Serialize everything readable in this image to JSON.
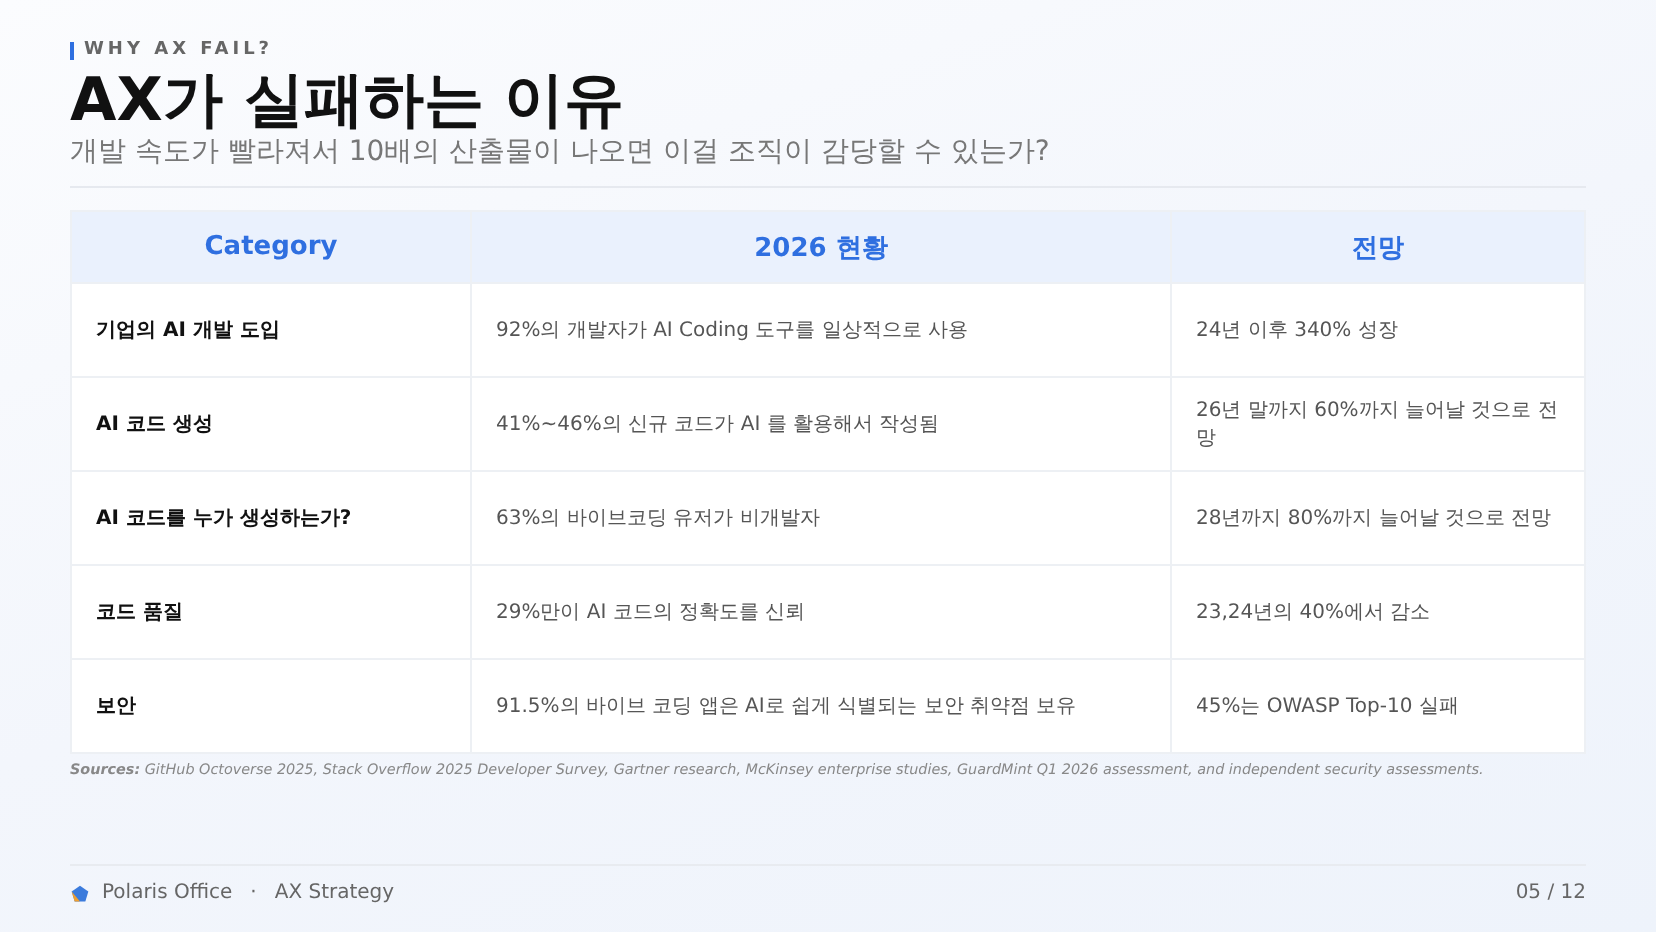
{
  "header": {
    "eyebrow": "WHY AX FAIL?",
    "title": "AX가 실패하는 이유",
    "subtitle": "개발 속도가 빨라져서 10배의 산출물이 나오면 이걸 조직이 감당할 수 있는가?"
  },
  "table": {
    "columns": [
      "Category",
      "2026 현황",
      "전망"
    ],
    "rows": [
      [
        "기업의 AI 개발 도입",
        "92%의 개발자가 AI Coding 도구를 일상적으로 사용",
        "24년 이후 340% 성장"
      ],
      [
        "AI 코드 생성",
        "41%~46%의 신규 코드가 AI 를 활용해서 작성됨",
        "26년 말까지 60%까지 늘어날 것으로 전망"
      ],
      [
        "AI 코드를 누가 생성하는가?",
        "63%의 바이브코딩 유저가 비개발자",
        "28년까지 80%까지 늘어날 것으로 전망"
      ],
      [
        "코드 품질",
        "29%만이 AI 코드의 정확도를 신뢰",
        "23,24년의 40%에서 감소"
      ],
      [
        "보안",
        "91.5%의 바이브 코딩 앱은 AI로 쉽게 식별되는 보안 취약점 보유",
        "45%는 OWASP Top-10 실패"
      ]
    ]
  },
  "sources": "**Sources:** GitHub Octoverse 2025, Stack Overflow 2025 Developer Survey, Gartner research, McKinsey enterprise studies, GuardMint Q1 2026 assessment, and independent security assessments.",
  "footer": {
    "brand": "Polaris Office",
    "separator": "·",
    "deck": "AX Strategy",
    "page": "05 / 12"
  }
}
